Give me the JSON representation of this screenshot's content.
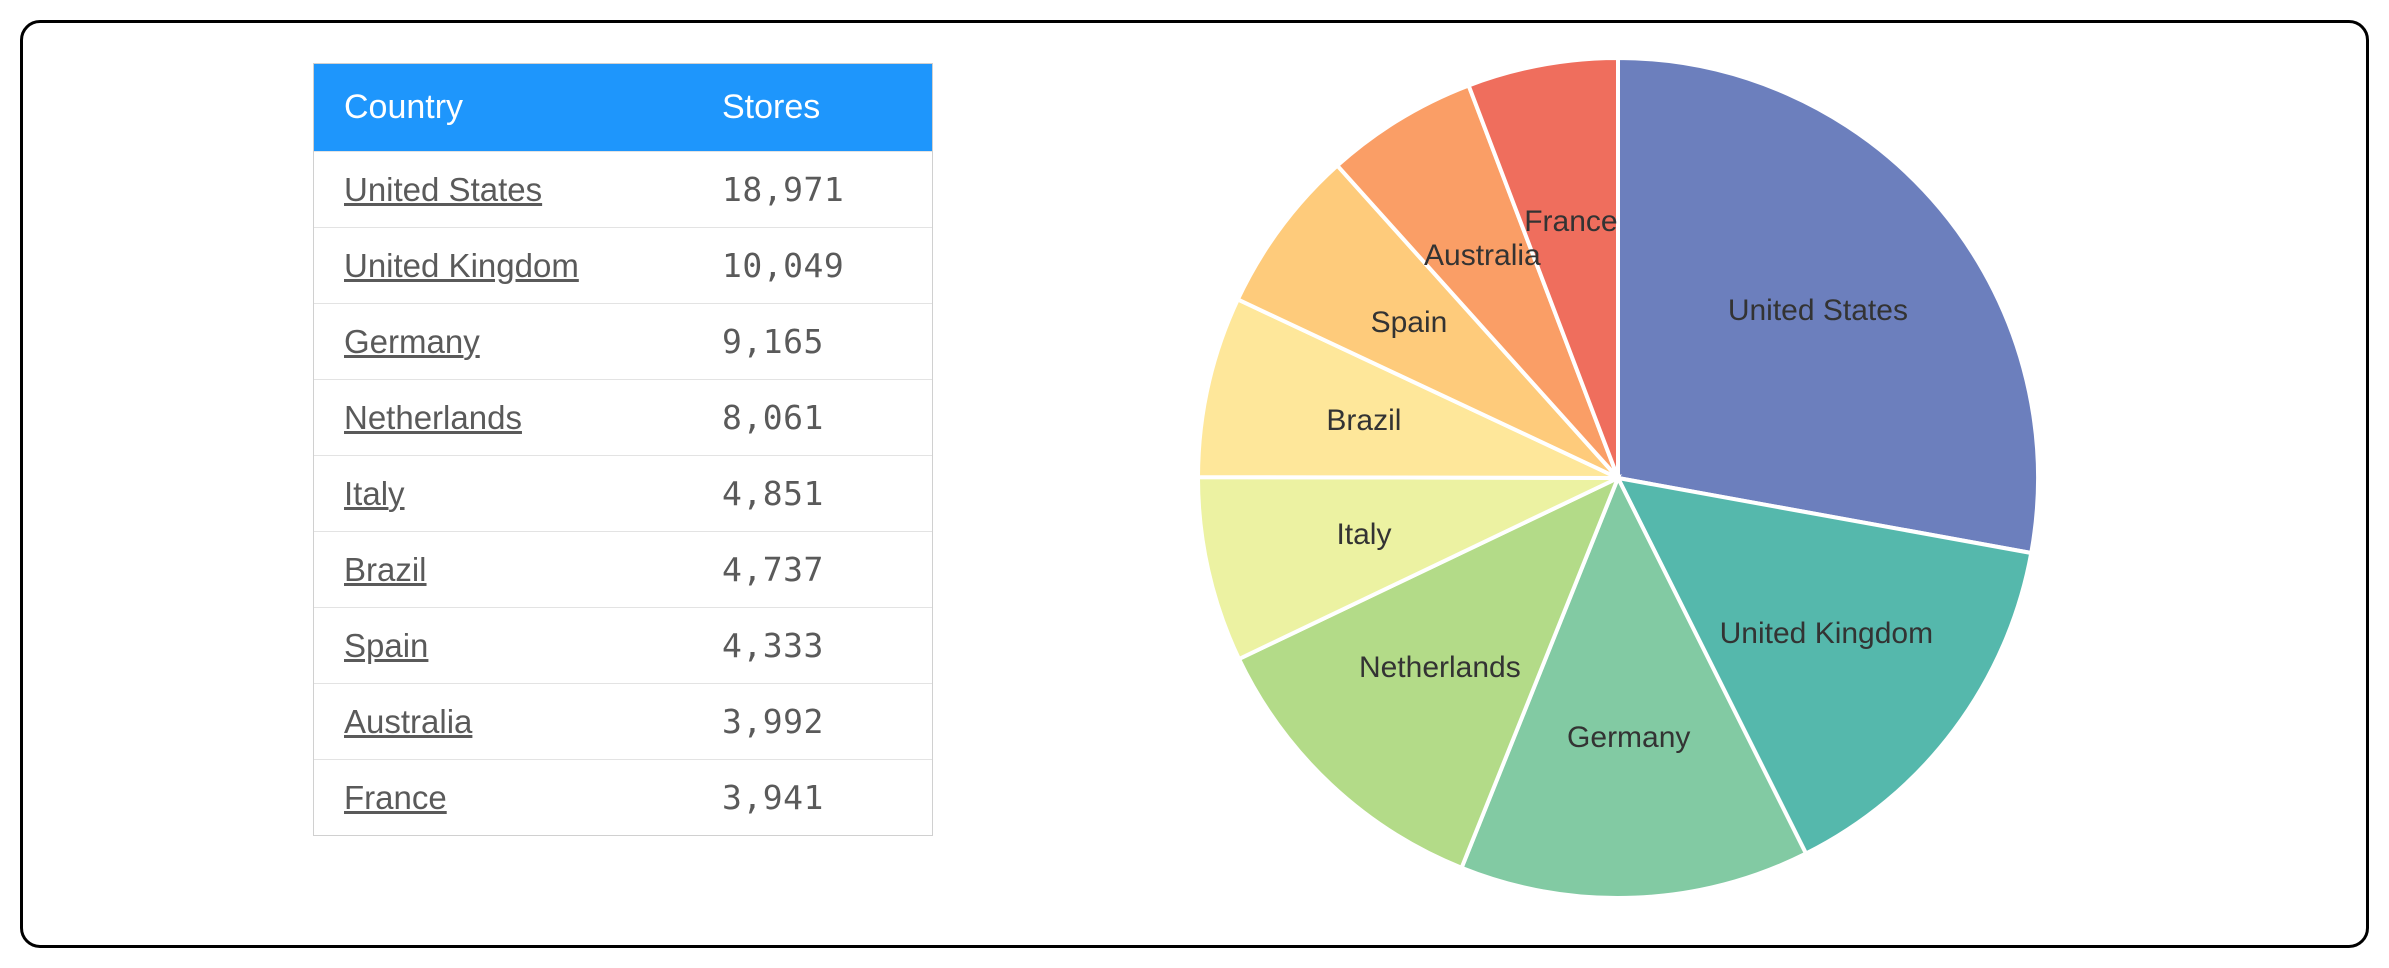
{
  "table": {
    "headers": {
      "country": "Country",
      "stores": "Stores"
    },
    "rows": [
      {
        "country": "United States",
        "stores": "18,971"
      },
      {
        "country": "United Kingdom",
        "stores": "10,049"
      },
      {
        "country": "Germany",
        "stores": "9,165"
      },
      {
        "country": "Netherlands",
        "stores": "8,061"
      },
      {
        "country": "Italy",
        "stores": "4,851"
      },
      {
        "country": "Brazil",
        "stores": "4,737"
      },
      {
        "country": "Spain",
        "stores": "4,333"
      },
      {
        "country": "Australia",
        "stores": "3,992"
      },
      {
        "country": "France",
        "stores": "3,941"
      }
    ]
  },
  "chart_data": {
    "type": "pie",
    "title": "",
    "series": [
      {
        "name": "United States",
        "value": 18971,
        "color": "#6c7fbd"
      },
      {
        "name": "United Kingdom",
        "value": 10049,
        "color": "#55b8ac"
      },
      {
        "name": "Germany",
        "value": 9165,
        "color": "#82caa3"
      },
      {
        "name": "Netherlands",
        "value": 8061,
        "color": "#b3db88"
      },
      {
        "name": "Italy",
        "value": 4851,
        "color": "#ecf2a2"
      },
      {
        "name": "Brazil",
        "value": 4737,
        "color": "#fee79a"
      },
      {
        "name": "Spain",
        "value": 4333,
        "color": "#fecb7b"
      },
      {
        "name": "Australia",
        "value": 3992,
        "color": "#fa9e66"
      },
      {
        "name": "France",
        "value": 3941,
        "color": "#ef6e5d"
      }
    ]
  }
}
